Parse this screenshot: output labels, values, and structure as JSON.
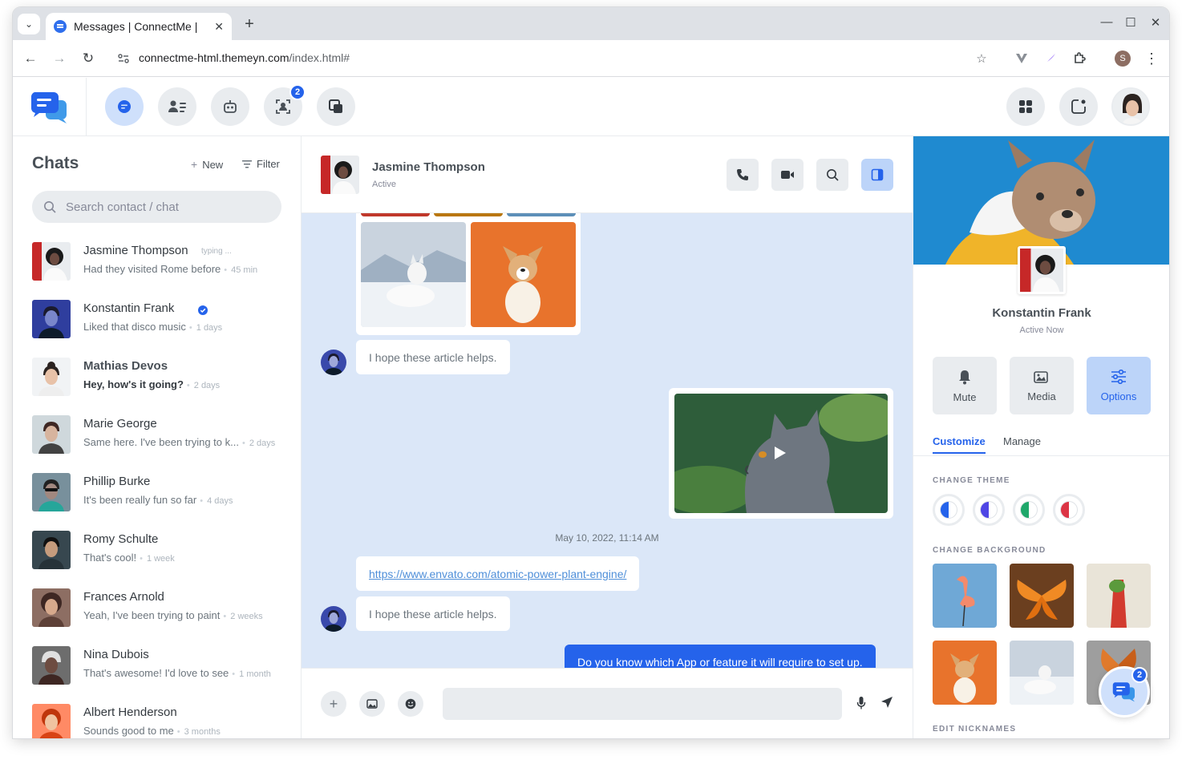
{
  "browser": {
    "tab_title": "Messages | ConnectMe |",
    "url_host": "connectme-html.themeyn.com",
    "url_path": "/index.html#",
    "profile_initial": "S"
  },
  "nav": {
    "requests_badge": "2"
  },
  "sidebar": {
    "title": "Chats",
    "new_label": "New",
    "filter_label": "Filter",
    "search_placeholder": "Search contact / chat",
    "chats": [
      {
        "name": "Jasmine Thompson",
        "typing": "typing ...",
        "message": "Had they visited Rome before",
        "time": "45 min",
        "unread": false
      },
      {
        "name": "Konstantin Frank",
        "verified": true,
        "message": "Liked that disco music",
        "time": "1 days",
        "unread": false
      },
      {
        "name": "Mathias Devos",
        "message": "Hey, how's it going?",
        "time": "2 days",
        "unread": true
      },
      {
        "name": "Marie George",
        "message": "Same here. I've been trying to k...",
        "time": "2 days",
        "unread": false
      },
      {
        "name": "Phillip Burke",
        "message": "It's been really fun so far",
        "time": "4 days",
        "unread": false
      },
      {
        "name": "Romy Schulte",
        "message": "That's cool!",
        "time": "1 week",
        "unread": false
      },
      {
        "name": "Frances Arnold",
        "message": "Yeah, I've been trying to paint",
        "time": "2 weeks",
        "unread": false
      },
      {
        "name": "Nina Dubois",
        "message": "That's awesome! I'd love to see",
        "time": "1 month",
        "unread": false
      },
      {
        "name": "Albert Henderson",
        "message": "Sounds good to me",
        "time": "3 months",
        "unread": false
      }
    ]
  },
  "chat": {
    "contact_name": "Jasmine Thompson",
    "contact_status": "Active",
    "messages": {
      "text_1": "I hope these article helps.",
      "date": "May 10, 2022, 11:14 AM",
      "link": "https://www.envato.com/atomic-power-plant-engine/",
      "text_2": "I hope these article helps.",
      "outgoing": "Do you know which App or feature it will require to set up."
    }
  },
  "panel": {
    "name": "Konstantin Frank",
    "status": "Active Now",
    "mute_label": "Mute",
    "media_label": "Media",
    "options_label": "Options",
    "tab_customize": "Customize",
    "tab_manage": "Manage",
    "change_theme": "CHANGE THEME",
    "change_background": "CHANGE BACKGROUND",
    "edit_nicknames": "EDIT NICKNAMES",
    "theme_colors": [
      "#2563eb",
      "#4f46e5",
      "#20a86b",
      "#dc3545"
    ]
  },
  "fab": {
    "badge": "2"
  }
}
